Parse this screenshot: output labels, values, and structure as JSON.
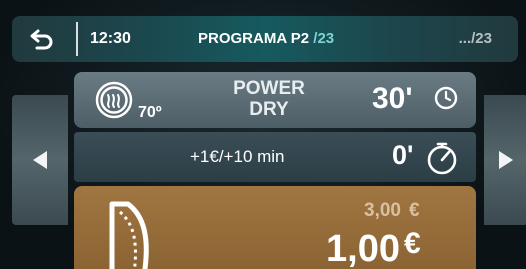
{
  "header": {
    "back_icon": "back-arrow-icon",
    "clock": "12:30",
    "program_title": "PROGRAMA P2 ",
    "program_count": "/23",
    "right_indicator": ".../23"
  },
  "navigation": {
    "left_icon": "triangle-left-icon",
    "right_icon": "triangle-right-icon"
  },
  "program": {
    "icon": "drying-icon",
    "temperature": "70º",
    "name_line1": "POWER",
    "name_line2": "DRY",
    "duration": "30'",
    "duration_icon": "clock-icon"
  },
  "extra": {
    "label": "+1€/+10 min",
    "time": "0'",
    "timer_icon": "stopwatch-icon"
  },
  "price": {
    "icon": "cup-icon",
    "original": "3,00",
    "original_currency": "€",
    "current": "1,00",
    "current_currency": "€"
  },
  "colors": {
    "header_accent": "#165a5e",
    "count_accent": "#7fd3d0",
    "program_card": "#5b6c75",
    "extra_row": "#33464f",
    "price_card": "#96703a"
  }
}
